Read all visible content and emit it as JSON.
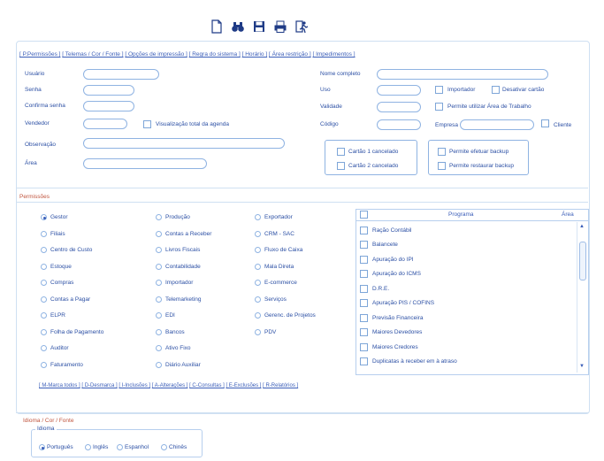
{
  "toolbar": {
    "icons": [
      "new-document-icon",
      "binoculars-icon",
      "save-icon",
      "print-icon",
      "exit-icon"
    ]
  },
  "tabs": [
    "[ P.Permissões ]",
    "[ Telemas / Cor / Fonte ]",
    "[ Opções de impressão ]",
    "[ Regra do sistema ]",
    "[ Horário ]",
    "[ Área restrição ]",
    "[ Impedimentos ]"
  ],
  "user_form": {
    "usuario_label": "Usuário",
    "senha_label": "Senha",
    "confirma_label": "Confirma senha",
    "vendedor_label": "Vendedor",
    "visualizacao_label": "Visualização total da agenda",
    "observacao_label": "Observação",
    "area_label": "Área",
    "nome_completo_label": "Nome completo",
    "uso_label": "Uso",
    "importador_label": "Importador",
    "desativar_label": "Desativar cartão",
    "validade_label": "Validade",
    "area_trabalho_label": "Permite utilizar Área de Trabalho",
    "codigo_label": "Código",
    "empresa_label": "Empresa",
    "cliente_label": "Cliente",
    "cartao1_label": "Cartão 1 cancelado",
    "cartao2_label": "Cartão 2 cancelado",
    "backup_label": "Permite efetuar backup",
    "restaurar_label": "Permite restaurar backup"
  },
  "permissoes": {
    "title": "Permissões",
    "col1": [
      "Gestor",
      "Filiais",
      "Centro de Custo",
      "Estoque",
      "Compras",
      "Contas a Pagar",
      "ELPR",
      "Folha de Pagamento",
      "Auditor",
      "Faturamento"
    ],
    "col2": [
      "Produção",
      "Contas a Receber",
      "Livros Fiscais",
      "Contabilidade",
      "Importador",
      "Telemarketing",
      "EDI",
      "Bancos",
      "Ativo Fixo",
      "Diário Auxiliar"
    ],
    "col3": [
      "Exportador",
      "CRM - SAC",
      "Fluxo de Caixa",
      "Mala Direta",
      "E-commerce",
      "Serviços",
      "Gerenc. de Projetos",
      "PDV"
    ],
    "selected": "Gestor"
  },
  "programas": {
    "header_programa": "Programa",
    "header_area": "Área",
    "rows": [
      "Ração Contábil",
      "Balancete",
      "Apuração do IPI",
      "Apuração do ICMS",
      "D.R.E.",
      "Apuração PIS / COFINS",
      "Previsão Financeira",
      "Maiores Devedores",
      "Maiores Credores",
      "Duplicatas à receber em à atraso"
    ]
  },
  "quick_links": [
    "[ M-Marca todos ]",
    "[ D-Desmarca ]",
    "[ I-Inclusões ]",
    "[ A-Alterações ]",
    "[ C-Consultas ]",
    "[ E-Exclusões ]",
    "[ R-Relatórios ]"
  ],
  "idioma": {
    "section_title": "Idioma / Cor / Fonte",
    "legend": "Idioma",
    "options": [
      "Português",
      "Inglês",
      "Espanhol",
      "Chinês"
    ],
    "selected": "Português"
  }
}
